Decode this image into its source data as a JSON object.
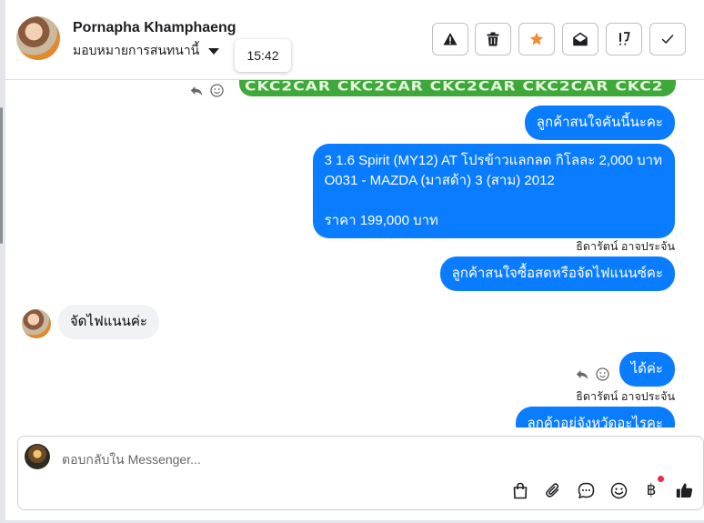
{
  "header": {
    "contact_name": "Pornapha Khamphaeng",
    "assign_label": "มอบหมายการสนทนานี้",
    "tooltip_time": "15:42",
    "actions": [
      {
        "name": "report-button",
        "icon": "warning-icon"
      },
      {
        "name": "delete-button",
        "icon": "trash-icon"
      },
      {
        "name": "star-button",
        "icon": "star-icon"
      },
      {
        "name": "mark-unread-button",
        "icon": "envelope-open-icon"
      },
      {
        "name": "follow-up-button",
        "icon": "follow-up-icon"
      },
      {
        "name": "done-button",
        "icon": "check-icon"
      }
    ]
  },
  "chat": {
    "image_caption": "CKC2CAR CKC2CAR CKC2CAR CKC2CAR CKC2",
    "messages": [
      {
        "direction": "out",
        "text": "ลูกค้าสนใจคันนี้นะคะ"
      },
      {
        "direction": "out",
        "lines": [
          "3 1.6 Spirit (MY12) AT โปรข้าวแลกลด กิโลละ 2,000 บาท",
          "O031 - MAZDA (มาสด้า) 3 (สาม) 2012",
          "",
          "ราคา 199,000 บาท"
        ],
        "sender": "ธิดารัตน์ อาจประจัน"
      },
      {
        "direction": "out",
        "text": "ลูกค้าสนใจซื้อสดหรือจัดไฟแนนซ์คะ"
      },
      {
        "direction": "in",
        "text": "จัดไฟแนนค่ะ"
      },
      {
        "direction": "out",
        "text": "ได้ค่ะ",
        "sender": "ธิดารัตน์ อาจประจัน"
      },
      {
        "direction": "out",
        "text": "ลูกค้าอยู่จังหวัดอะไรคะ"
      }
    ]
  },
  "composer": {
    "placeholder": "ตอบกลับใน Messenger...",
    "tools": [
      "shopping-bag-icon",
      "paperclip-icon",
      "saved-reply-icon",
      "emoji-icon",
      "baht-payment-icon",
      "thumbs-up-icon"
    ],
    "baht_symbol": "฿"
  },
  "colors": {
    "outgoing_bubble": "#0a7cff",
    "incoming_bubble": "#f0f2f5",
    "star": "#f28b2c",
    "notification_dot": "#f02849"
  }
}
